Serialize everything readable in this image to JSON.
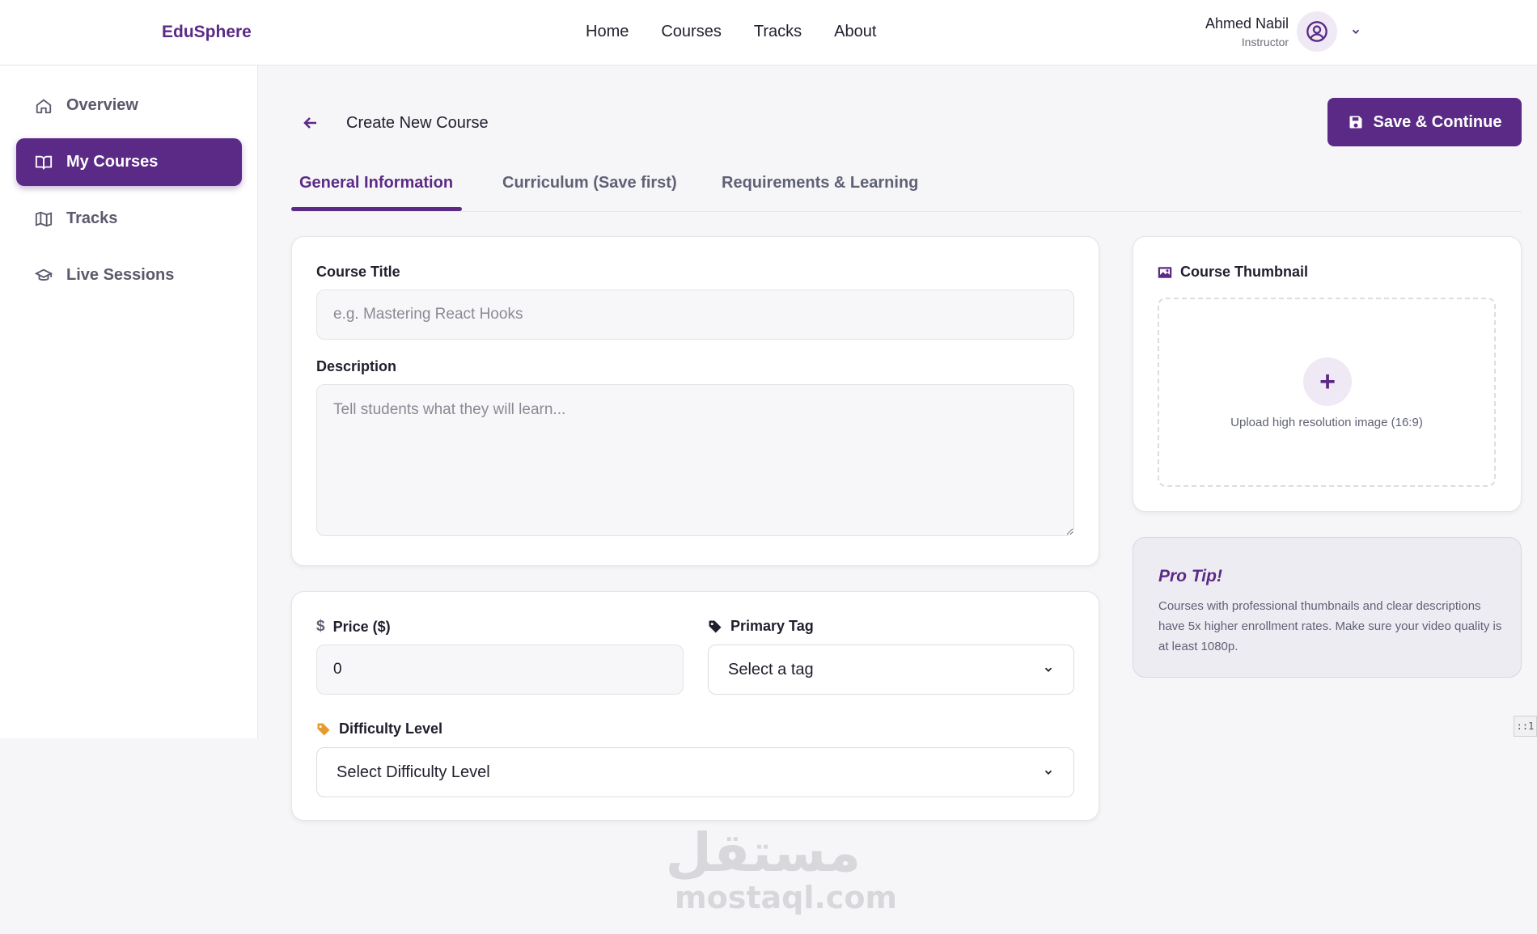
{
  "brand": "EduSphere",
  "nav": {
    "home": "Home",
    "courses": "Courses",
    "tracks": "Tracks",
    "about": "About"
  },
  "user": {
    "name": "Ahmed Nabil",
    "role": "Instructor",
    "avatar_icon": "user-circle-icon"
  },
  "sidebar": {
    "items": [
      {
        "label": "Overview",
        "icon": "home-icon",
        "active": false
      },
      {
        "label": "My Courses",
        "icon": "book-open-icon",
        "active": true
      },
      {
        "label": "Tracks",
        "icon": "map-icon",
        "active": false
      },
      {
        "label": "Live Sessions",
        "icon": "graduation-cap-icon",
        "active": false
      }
    ]
  },
  "header": {
    "title": "Create New Course",
    "save_label": "Save & Continue"
  },
  "tabs": [
    {
      "label": "General Information",
      "active": true
    },
    {
      "label": "Curriculum (Save first)",
      "active": false
    },
    {
      "label": "Requirements & Learning",
      "active": false
    }
  ],
  "form": {
    "course_title": {
      "label": "Course Title",
      "placeholder": "e.g. Mastering React Hooks",
      "value": ""
    },
    "description": {
      "label": "Description",
      "placeholder": "Tell students what they will learn...",
      "value": ""
    },
    "price": {
      "label": "Price ($)",
      "value": "0"
    },
    "primary_tag": {
      "label": "Primary Tag",
      "selected": "Select a tag"
    },
    "difficulty": {
      "label": "Difficulty Level",
      "selected": "Select Difficulty Level"
    }
  },
  "thumbnail": {
    "label": "Course Thumbnail",
    "upload_text": "Upload high resolution image (16:9)"
  },
  "tip": {
    "title": "Pro Tip!",
    "text": "Courses with professional thumbnails and clear descriptions have 5x higher enrollment rates. Make sure your video quality is at least 1080p."
  },
  "corner_marker": "::1",
  "watermark": {
    "arabic": "مستقل",
    "latin": "mostaql.com"
  },
  "colors": {
    "accent": "#5b2a86",
    "accent_light": "#efe9f5",
    "tag_orange": "#e89a2c"
  }
}
